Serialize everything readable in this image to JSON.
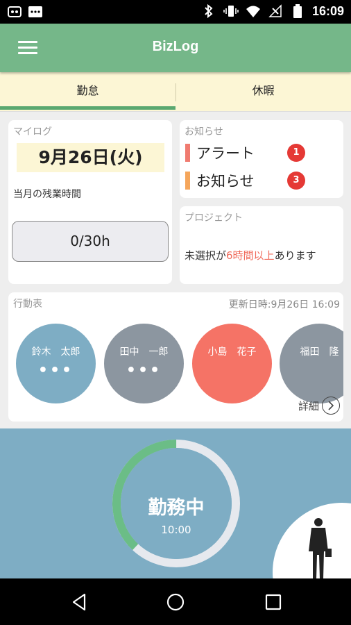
{
  "status_bar": {
    "time": "16:09"
  },
  "app_bar": {
    "title": "BizLog"
  },
  "tabs": [
    {
      "label": "勤怠"
    },
    {
      "label": "休暇"
    }
  ],
  "mylog": {
    "label": "マイログ",
    "date": "9月26日(火)",
    "overtime_label": "当月の残業時間",
    "overtime_value": "0/30h"
  },
  "notices": {
    "label": "お知らせ",
    "items": [
      {
        "label": "アラート",
        "count": "1",
        "color": "#f07b70"
      },
      {
        "label": "お知らせ",
        "count": "3",
        "color": "#f5a65b"
      }
    ]
  },
  "project": {
    "label": "プロジェクト",
    "message_pre": "未選択が",
    "message_highlight": "6時間以上",
    "message_post": "あります"
  },
  "schedule": {
    "label": "行動表",
    "updated": "更新日時:9月26日 16:09",
    "people": [
      {
        "name": "鈴木　太郎",
        "status": "•••",
        "color": "#7eadc4"
      },
      {
        "name": "田中　一郎",
        "status": "•••",
        "color": "#8c96a0"
      },
      {
        "name": "小島　花子",
        "status": "",
        "color": "#f57366"
      },
      {
        "name": "福田　隆",
        "status": "",
        "color": "#8c96a0"
      }
    ],
    "detail_label": "詳細"
  },
  "work_status": {
    "label": "勤務中",
    "time": "10:00",
    "progress": 0.38
  },
  "colors": {
    "accent": "#75b789",
    "tab_bg": "#fcf6d5",
    "panel": "#7eadc4"
  }
}
